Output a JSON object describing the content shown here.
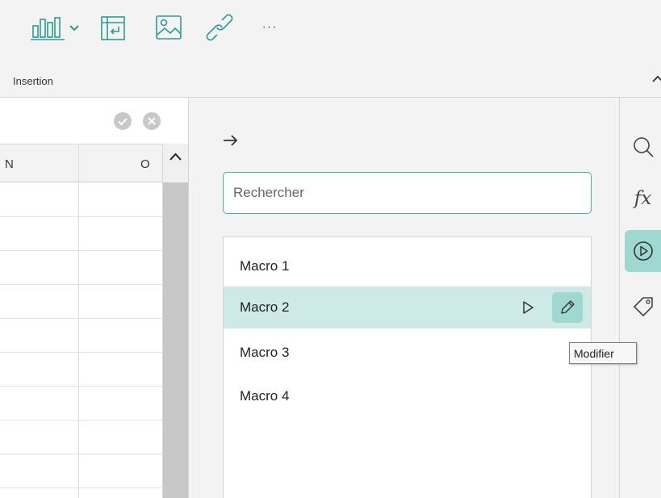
{
  "ribbon": {
    "group_label": "Insertion",
    "icons": [
      "chart-icon",
      "chevron-down-icon",
      "pivot-table-icon",
      "image-icon",
      "link-icon",
      "more-icon",
      "collapse-ribbon-icon"
    ],
    "more_label": "···"
  },
  "sheet": {
    "columns": [
      "N",
      "O"
    ],
    "confirm_icons": [
      "check-icon",
      "cancel-icon"
    ]
  },
  "panel": {
    "search_placeholder": "Rechercher",
    "macros": [
      {
        "label": "Macro 1",
        "selected": false
      },
      {
        "label": "Macro 2",
        "selected": true
      },
      {
        "label": "Macro 3",
        "selected": false
      },
      {
        "label": "Macro 4",
        "selected": false
      }
    ],
    "tooltip": "Modifier"
  },
  "sidebar": {
    "items": [
      {
        "icon": "search-icon",
        "active": false
      },
      {
        "icon": "function-icon",
        "label": "fx",
        "active": false
      },
      {
        "icon": "macro-play-icon",
        "active": true
      },
      {
        "icon": "tag-icon",
        "active": false
      }
    ]
  },
  "colors": {
    "accent": "#3fb3a8",
    "selected_row": "#cdeae6",
    "active_button": "#9fd8d0",
    "icon_teal": "#2a9d8f"
  }
}
